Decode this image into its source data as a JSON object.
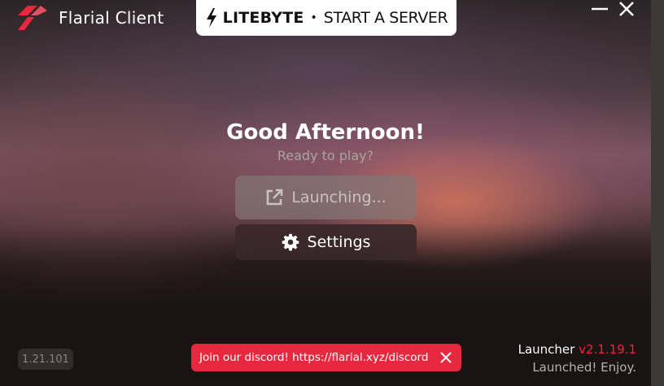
{
  "app": {
    "title": "Flarial Client"
  },
  "ad": {
    "brand": "LITEBYTE",
    "separator": "•",
    "cta": "START A SERVER"
  },
  "main": {
    "greeting": "Good Afternoon!",
    "subtitle": "Ready to play?",
    "launch_label": "Launching...",
    "settings_label": "Settings"
  },
  "footer": {
    "game_version": "1.21.101",
    "toast_text": "Join our discord! https://flarial.xyz/discord",
    "launcher_label": "Launcher",
    "launcher_version": "v2.1.19.1",
    "status": "Launched! Enjoy."
  },
  "colors": {
    "accent": "#e8283e",
    "ad_bg": "#ffffff"
  },
  "icons": [
    "flarial-logo-icon",
    "lightning-bolt-icon",
    "minimize-icon",
    "close-icon",
    "external-link-icon",
    "gear-icon",
    "toast-close-icon"
  ]
}
